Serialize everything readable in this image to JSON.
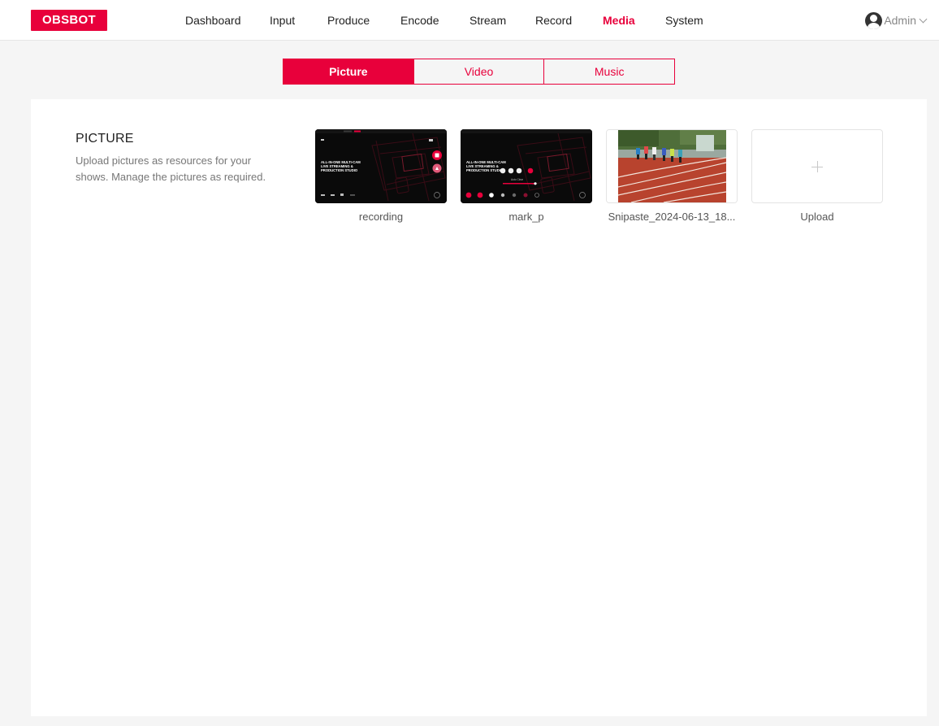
{
  "brand": {
    "logo_text": "OBSBOT",
    "accent": "#e8003b"
  },
  "nav": {
    "items": [
      {
        "label": "Dashboard"
      },
      {
        "label": "Input"
      },
      {
        "label": "Produce"
      },
      {
        "label": "Encode"
      },
      {
        "label": "Stream"
      },
      {
        "label": "Record"
      },
      {
        "label": "Media",
        "active": true
      },
      {
        "label": "System"
      }
    ]
  },
  "user": {
    "name": "Admin",
    "icon": "user-avatar-icon"
  },
  "tabs": [
    {
      "label": "Picture",
      "active": true
    },
    {
      "label": "Video"
    },
    {
      "label": "Music"
    }
  ],
  "section": {
    "title": "PICTURE",
    "description": "Upload pictures as resources for your shows. Manage the pictures as required."
  },
  "pictures": [
    {
      "name": "recording",
      "thumb_text": "ALL-IN-ONE MULTI-CAM LIVE STREAMING & PRODUCTION STUDIO"
    },
    {
      "name": "mark_p",
      "thumb_text": "ALL-IN-ONE MULTI-CAM LIVE STREAMING & PRODUCTION STUDIO"
    },
    {
      "name": "Snipaste_2024-06-13_18..."
    }
  ],
  "upload": {
    "label": "Upload",
    "icon": "plus-icon"
  }
}
